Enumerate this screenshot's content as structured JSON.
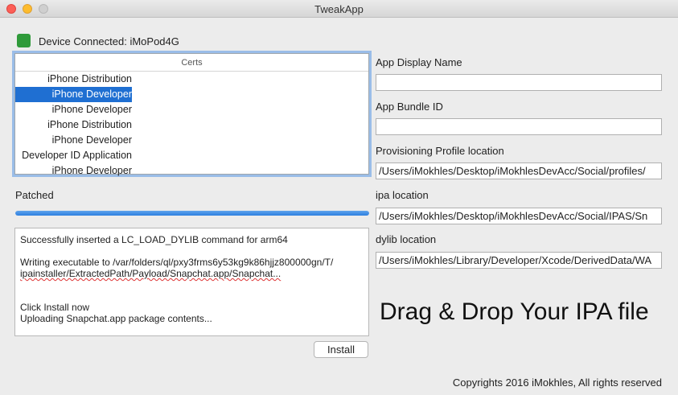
{
  "window": {
    "title": "TweakApp"
  },
  "device": {
    "status_color": "#2f9a3a",
    "label": "Device Connected: iMoPod4G"
  },
  "certs": {
    "header": "Certs",
    "items": [
      "iPhone Distribution",
      "iPhone Developer",
      "iPhone Developer",
      "iPhone Distribution",
      "iPhone Developer",
      "Developer ID Application",
      "iPhone Developer"
    ],
    "selected_index": 1
  },
  "progress": {
    "label": "Patched",
    "value": 1.0
  },
  "log": {
    "lines": [
      "Successfully inserted a LC_LOAD_DYLIB command for arm64",
      "",
      "Writing executable to /var/folders/ql/pxy3frms6y53kg9k86hjjz800000gn/T/",
      "ipainstaller/ExtractedPath/Payload/Snapchat.app/Snapchat...",
      "",
      "",
      "Click Install now",
      "Uploading Snapchat.app package contents..."
    ]
  },
  "install_button": "Install",
  "form": {
    "app_display_name": {
      "label": "App Display Name",
      "value": ""
    },
    "app_bundle_id": {
      "label": "App Bundle ID",
      "value": ""
    },
    "provisioning_profile": {
      "label": "Provisioning Profile location",
      "value": "/Users/iMokhles/Desktop/iMokhlesDevAcc/Social/profiles/"
    },
    "ipa_location": {
      "label": "ipa location",
      "value": "/Users/iMokhles/Desktop/iMokhlesDevAcc/Social/IPAS/Sn"
    },
    "dylib_location": {
      "label": "dylib location",
      "value": "/Users/iMokhles/Library/Developer/Xcode/DerivedData/WA"
    }
  },
  "drop_zone": "Drag & Drop Your IPA file",
  "footer": "Copyrights 2016 iMokhles, All rights reserved"
}
